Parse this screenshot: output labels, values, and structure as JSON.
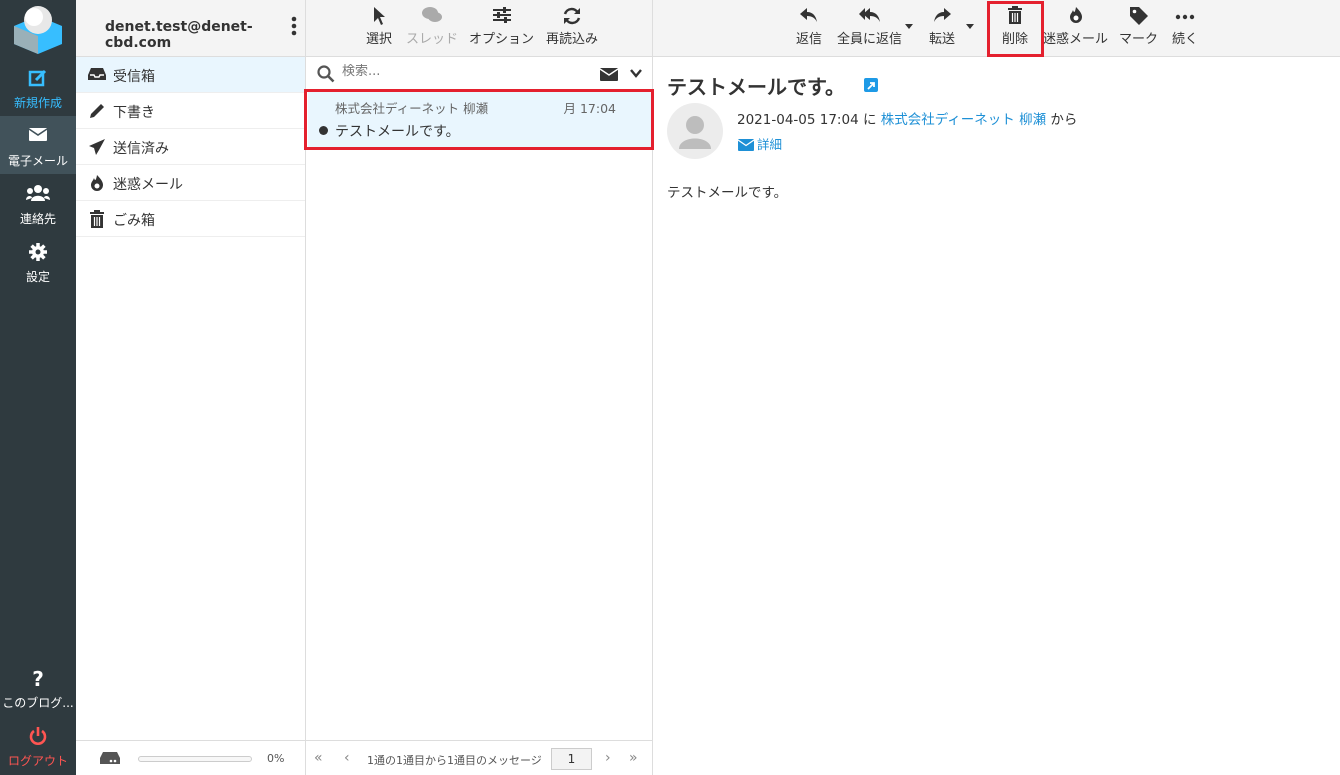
{
  "nav": {
    "compose": "新規作成",
    "mail": "電子メール",
    "contacts": "連絡先",
    "settings": "設定",
    "about": "このブログ...",
    "logout": "ログアウト"
  },
  "account": {
    "email": "denet.test@denet-cbd.com"
  },
  "folders": [
    {
      "label": "受信箱",
      "icon": "inbox-icon"
    },
    {
      "label": "下書き",
      "icon": "pencil-icon"
    },
    {
      "label": "送信済み",
      "icon": "paper-plane-icon"
    },
    {
      "label": "迷惑メール",
      "icon": "fire-icon"
    },
    {
      "label": "ごみ箱",
      "icon": "trash-icon"
    }
  ],
  "quota": {
    "percent_label": "0%",
    "percent": 0
  },
  "list_toolbar": {
    "select": "選択",
    "threads": "スレッド",
    "options": "オプション",
    "refresh": "再読込み"
  },
  "search": {
    "placeholder": "検索..."
  },
  "messages": [
    {
      "from": "株式会社ディーネット 柳瀬",
      "date": "月 17:04",
      "subject": "テストメールです。",
      "unread": true
    }
  ],
  "pager": {
    "text": "1通の1通目から1通目のメッセージ",
    "page": "1"
  },
  "pane_toolbar": {
    "reply": "返信",
    "reply_all": "全員に返信",
    "forward": "転送",
    "delete": "削除",
    "junk": "迷惑メール",
    "mark": "マーク",
    "more": "続く"
  },
  "message": {
    "subject": "テストメールです。",
    "datetime": "2021-04-05 17:04",
    "ni": "に",
    "sender": "株式会社ディーネット 柳瀬",
    "kara": "から",
    "details": "詳細",
    "body": "テストメールです。"
  },
  "colors": {
    "highlight": "#e4202e",
    "accent": "#37beff",
    "nav_bg": "#2f3a3f",
    "logout": "#ff5552"
  }
}
